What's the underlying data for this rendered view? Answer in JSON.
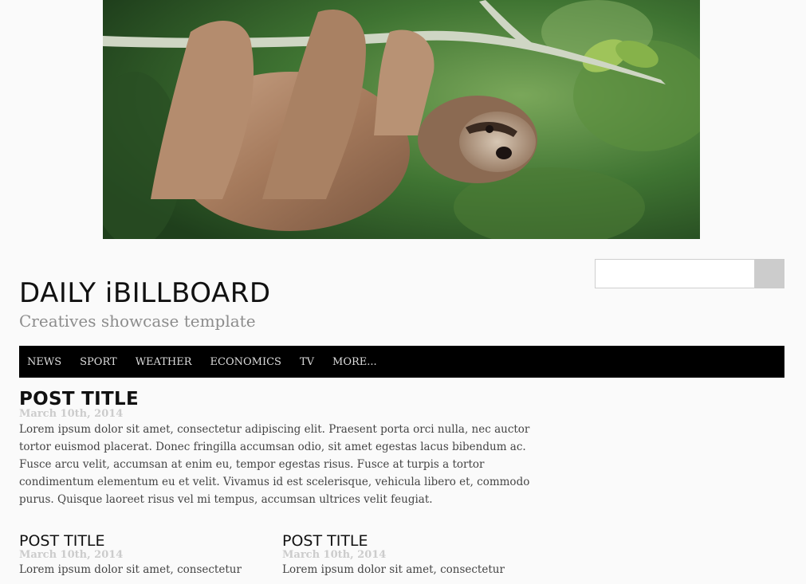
{
  "banner": {
    "image_alt": "Sloth hanging from a branch"
  },
  "search": {
    "placeholder": "",
    "value": "",
    "button_icon": "search-icon"
  },
  "header": {
    "title": "DAILY iBILLBOARD",
    "tagline": "Creatives showcase template"
  },
  "nav": {
    "items": [
      {
        "label": "NEWS"
      },
      {
        "label": "SPORT"
      },
      {
        "label": "WEATHER"
      },
      {
        "label": "ECONOMICS"
      },
      {
        "label": "TV"
      },
      {
        "label": "MORE..."
      }
    ]
  },
  "posts": {
    "featured": {
      "title": "POST TITLE",
      "date": "March 10th, 2014",
      "body": "Lorem ipsum dolor sit amet, consectetur adipiscing elit. Praesent porta orci nulla, nec auctor tortor euismod placerat. Donec fringilla accumsan odio, sit amet egestas lacus bibendum ac. Fusce arcu velit, accumsan at enim eu, tempor egestas risus. Fusce at turpis a tortor condimentum elementum eu et velit. Vivamus id est scelerisque, vehicula libero et, commodo purus. Quisque laoreet risus vel mi tempus, accumsan ultrices velit feugiat."
    },
    "secondary": [
      {
        "title": "POST TITLE",
        "date": "March 10th, 2014",
        "body": "Lorem ipsum dolor sit amet, consectetur"
      },
      {
        "title": "POST TITLE",
        "date": "March 10th, 2014",
        "body": "Lorem ipsum dolor sit amet, consectetur"
      }
    ]
  },
  "colors": {
    "page_background": "#fafafa",
    "nav_background": "#000000",
    "nav_text": "#dcdcdc",
    "tagline": "#8c8c8c",
    "date": "#cccccc",
    "search_button": "#cccccc"
  }
}
